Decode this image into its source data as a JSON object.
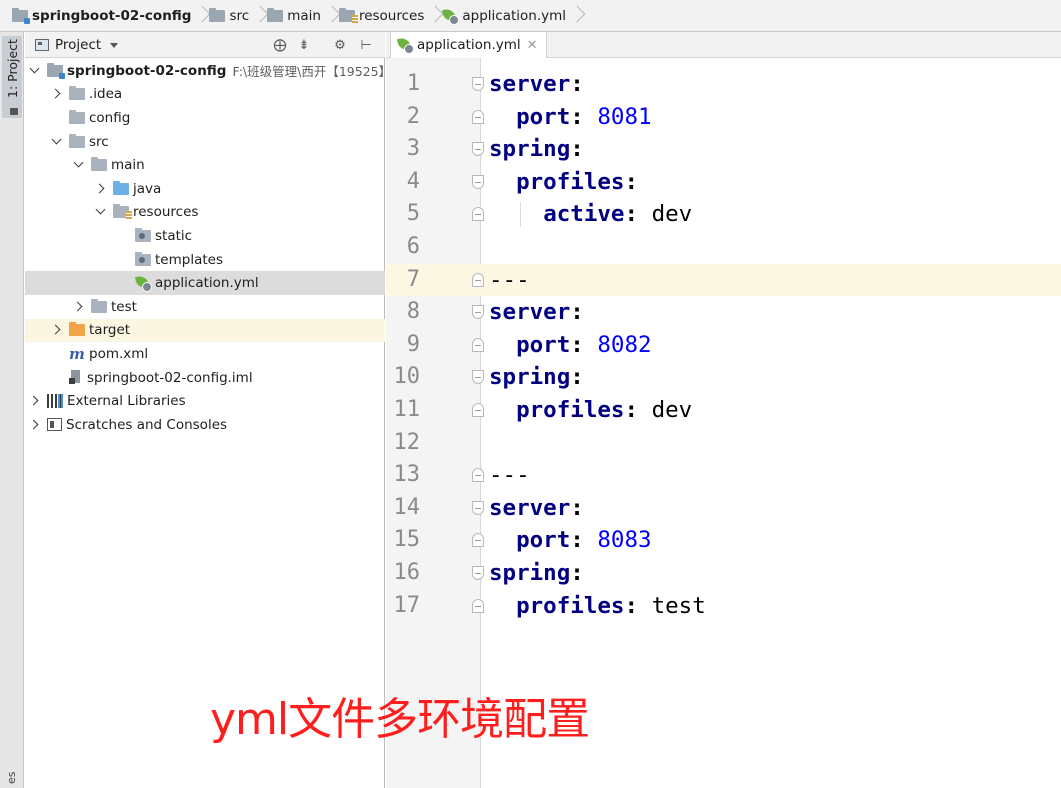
{
  "breadcrumb": [
    {
      "label": "springboot-02-config",
      "icon": "module-folder-icon"
    },
    {
      "label": "src",
      "icon": "folder-icon"
    },
    {
      "label": "main",
      "icon": "folder-icon"
    },
    {
      "label": "resources",
      "icon": "resources-folder-icon"
    },
    {
      "label": "application.yml",
      "icon": "yaml-file-icon"
    }
  ],
  "tool_stripe": {
    "project_label": "1: Project",
    "bottom_label": "es"
  },
  "project_panel": {
    "title": "Project",
    "tree": [
      {
        "label": "springboot-02-config",
        "path": "F:\\班级管理\\西开【19525】",
        "expanded": true
      },
      {
        "label": ".idea"
      },
      {
        "label": "config"
      },
      {
        "label": "src",
        "expanded": true
      },
      {
        "label": "main",
        "expanded": true
      },
      {
        "label": "java"
      },
      {
        "label": "resources",
        "expanded": true
      },
      {
        "label": "static"
      },
      {
        "label": "templates"
      },
      {
        "label": "application.yml",
        "selected": true
      },
      {
        "label": "test"
      },
      {
        "label": "target"
      },
      {
        "label": "pom.xml"
      },
      {
        "label": "springboot-02-config.iml"
      },
      {
        "label": "External Libraries"
      },
      {
        "label": "Scratches and Consoles"
      }
    ]
  },
  "editor": {
    "tab_label": "application.yml",
    "current_line": 7,
    "lines": [
      {
        "n": "1",
        "key": "server",
        "sep": ":",
        "value": ""
      },
      {
        "n": "2",
        "key": "port",
        "sep": ": ",
        "value": "8081",
        "numeric": true
      },
      {
        "n": "3",
        "key": "spring",
        "sep": ":",
        "value": ""
      },
      {
        "n": "4",
        "key": "profiles",
        "sep": ":",
        "value": ""
      },
      {
        "n": "5",
        "key": "active",
        "sep": ": ",
        "value": "dev"
      },
      {
        "n": "6",
        "key": "",
        "sep": "",
        "value": ""
      },
      {
        "n": "7",
        "key": "",
        "sep": "",
        "value": "---"
      },
      {
        "n": "8",
        "key": "server",
        "sep": ":",
        "value": ""
      },
      {
        "n": "9",
        "key": "port",
        "sep": ": ",
        "value": "8082",
        "numeric": true
      },
      {
        "n": "10",
        "key": "spring",
        "sep": ":",
        "value": ""
      },
      {
        "n": "11",
        "key": "profiles",
        "sep": ": ",
        "value": "dev"
      },
      {
        "n": "12",
        "key": "",
        "sep": "",
        "value": ""
      },
      {
        "n": "13",
        "key": "",
        "sep": "",
        "value": "---"
      },
      {
        "n": "14",
        "key": "server",
        "sep": ":",
        "value": ""
      },
      {
        "n": "15",
        "key": "port",
        "sep": ": ",
        "value": "8083",
        "numeric": true
      },
      {
        "n": "16",
        "key": "spring",
        "sep": ":",
        "value": ""
      },
      {
        "n": "17",
        "key": "profiles",
        "sep": ": ",
        "value": "test"
      }
    ]
  },
  "annotation": "yml文件多环境配置",
  "colors": {
    "yaml_key": "#000080",
    "yaml_number": "#0000ff",
    "annotation": "#ff1e1e",
    "current_line": "#fcf8e3",
    "selected_row": "#dcdcdc",
    "excluded_row": "#fbf6e2"
  }
}
